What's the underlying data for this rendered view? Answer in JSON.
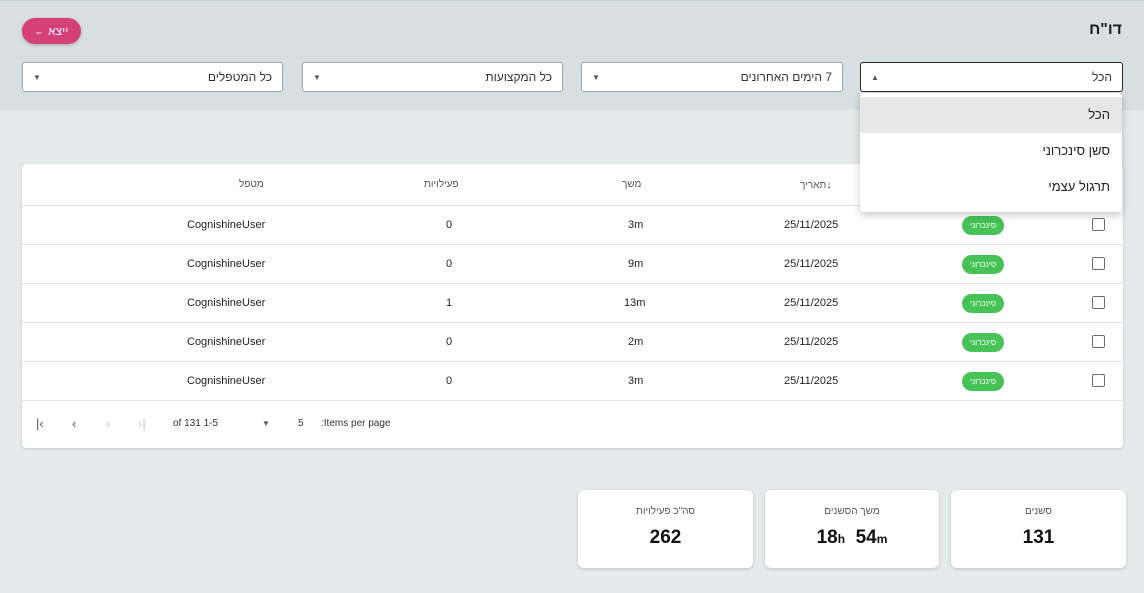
{
  "header": {
    "title": "דו\"ח",
    "export_label": "ייצא"
  },
  "filters": {
    "type": "הכל",
    "period": "7 הימים האחרונים",
    "professions": "כל המקצועות",
    "therapists": "כל המטפלים"
  },
  "dropdown": {
    "options": [
      "הכל",
      "סשן סינכרוני",
      "תרגול עצמי"
    ],
    "selected": "הכל"
  },
  "table": {
    "columns": {
      "date": "תאריך",
      "duration": "משך",
      "activities": "פעילויות",
      "therapist": "מטפל"
    },
    "rows": [
      {
        "badge": "סינכרוני",
        "date": "25/11/2025",
        "duration": "3m",
        "activities": "0",
        "therapist": "CognishineUser"
      },
      {
        "badge": "סינכרוני",
        "date": "25/11/2025",
        "duration": "9m",
        "activities": "0",
        "therapist": "CognishineUser"
      },
      {
        "badge": "סינכרוני",
        "date": "25/11/2025",
        "duration": "13m",
        "activities": "1",
        "therapist": "CognishineUser"
      },
      {
        "badge": "סינכרוני",
        "date": "25/11/2025",
        "duration": "2m",
        "activities": "0",
        "therapist": "CognishineUser"
      },
      {
        "badge": "סינכרוני",
        "date": "25/11/2025",
        "duration": "3m",
        "activities": "0",
        "therapist": "CognishineUser"
      }
    ],
    "paginator": {
      "items_per_page_label": ":Items per page",
      "page_size": "5",
      "range_label": "of 131 1-5"
    }
  },
  "stats": {
    "sessions": {
      "label": "סשנים",
      "value": "131"
    },
    "duration": {
      "label": "משך הסשנים",
      "hours": "18",
      "hours_unit": "h",
      "minutes": "54",
      "minutes_unit": "m"
    },
    "activities": {
      "label": "סה\"כ פעילויות",
      "value": "262"
    }
  },
  "colors": {
    "accent": "#d6407a",
    "badge": "#47c257",
    "header_band": "#d7dfe2",
    "background": "#e6eaeb"
  }
}
